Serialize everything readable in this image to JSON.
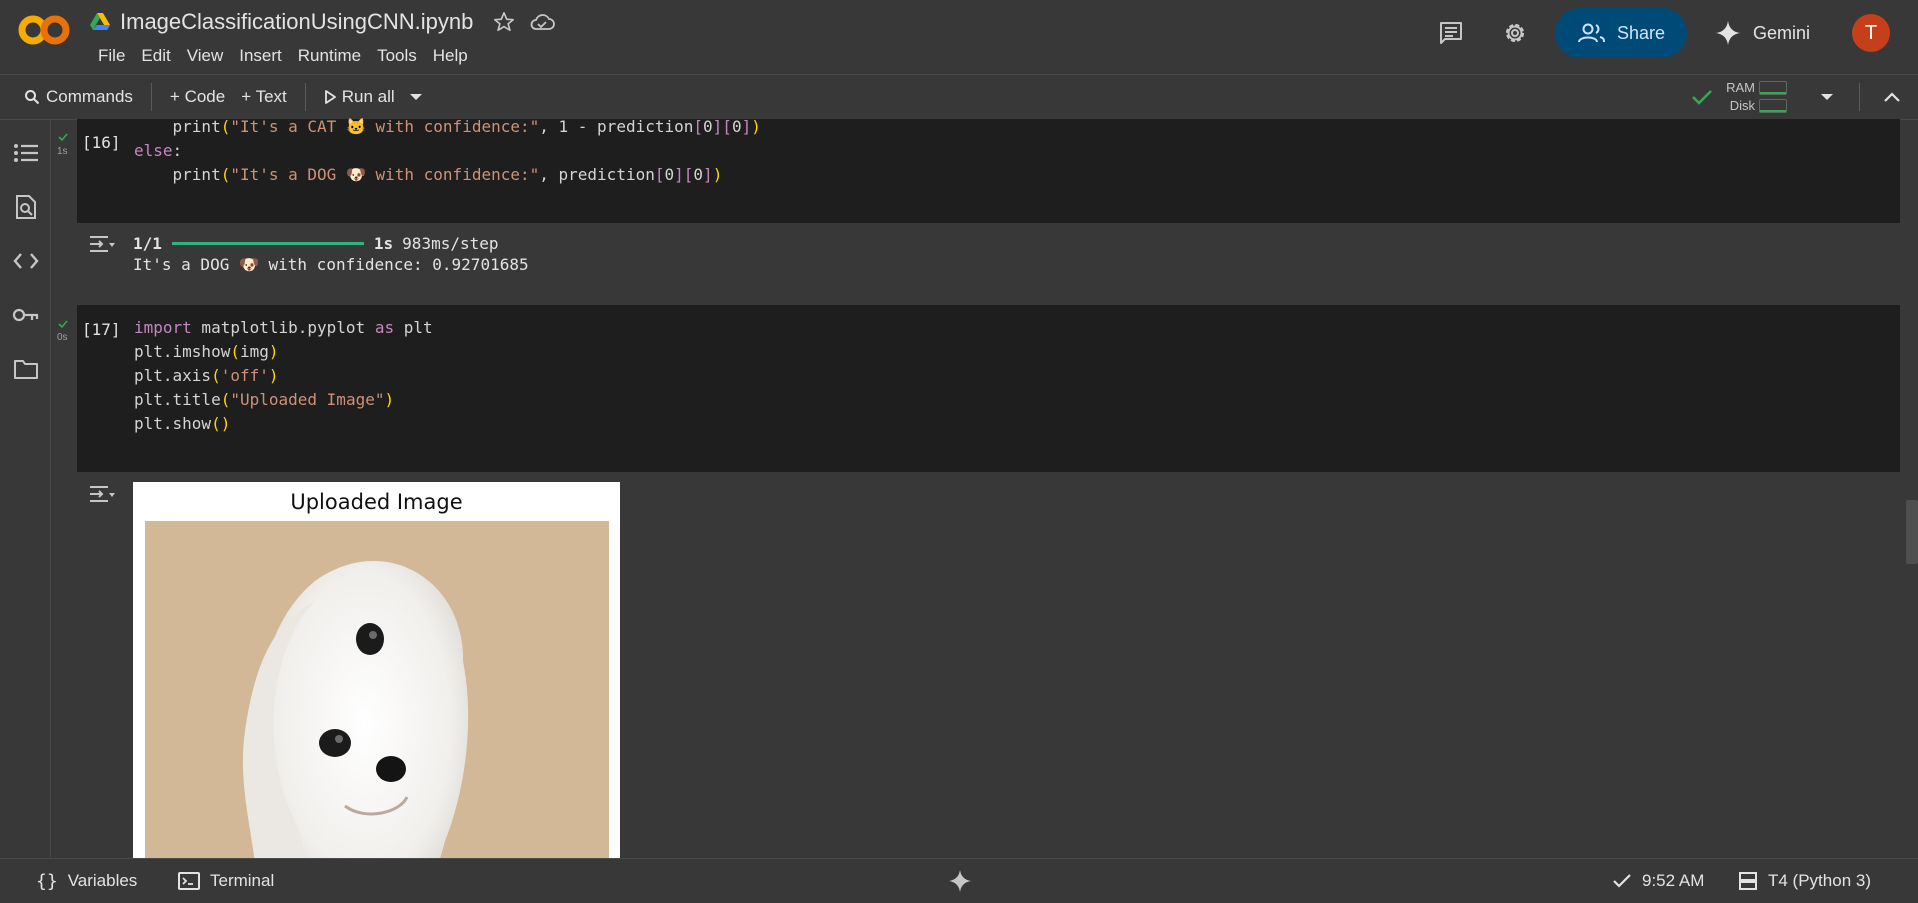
{
  "app": {
    "notebook_title": "ImageClassificationUsingCNN.ipynb",
    "menus": [
      "File",
      "Edit",
      "View",
      "Insert",
      "Runtime",
      "Tools",
      "Help"
    ],
    "share_label": "Share",
    "gemini_label": "Gemini",
    "avatar_initial": "T"
  },
  "toolbar": {
    "commands_label": "Commands",
    "code_label": "+ Code",
    "text_label": "+ Text",
    "run_all_label": "Run all",
    "ram_label": "RAM",
    "disk_label": "Disk"
  },
  "cells": [
    {
      "exec_count": "[16]",
      "time": "1s",
      "code_lines": [
        "    print(\"It's a CAT 🐱 with confidence:\", 1 - prediction[0][0])",
        "else:",
        "    print(\"It's a DOG 🐶 with confidence:\", prediction[0][0])"
      ],
      "output": {
        "progress_step": "1/1",
        "progress_fraction": 1.0,
        "progress_time": "1s",
        "progress_rate": "983ms/step",
        "result": "It's a DOG 🐶 with confidence: 0.92701685"
      }
    },
    {
      "exec_count": "[17]",
      "time": "0s",
      "code_lines": [
        "import matplotlib.pyplot as plt",
        "plt.imshow(img)",
        "plt.axis('off')",
        "plt.title(\"Uploaded Image\")",
        "plt.show()"
      ],
      "output": {
        "figure_title": "Uploaded Image"
      }
    }
  ],
  "statusbar": {
    "variables_label": "Variables",
    "terminal_label": "Terminal",
    "time_label": "9:52 AM",
    "runtime_label": "T4 (Python 3)"
  },
  "colors": {
    "accent_share": "#004a77",
    "success_green": "#34a853",
    "avatar": "#c5401a"
  },
  "icons": [
    "colab-logo",
    "drive-icon",
    "star-icon",
    "cloud-icon",
    "comment-icon",
    "gear-icon",
    "share-people-icon",
    "gemini-sparkle-icon",
    "search-icon",
    "play-icon",
    "chevron-down-icon",
    "checkmark-icon",
    "chevron-up-icon",
    "toc-icon",
    "find-icon",
    "code-icon",
    "key-icon",
    "folder-icon",
    "output-toggle-icon",
    "variables-icon",
    "terminal-icon",
    "runtime-icon"
  ]
}
